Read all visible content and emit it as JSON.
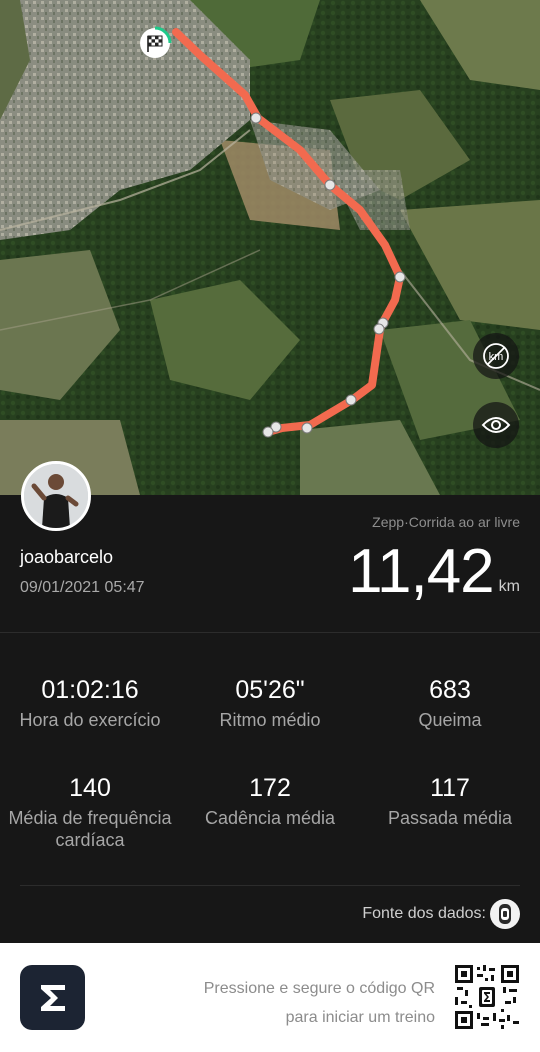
{
  "map": {
    "units_button_icon": "km-toggle-icon",
    "view_button_icon": "eye-icon",
    "start_marker_icon": "checkered-flag-icon",
    "route_color": "#f26a4f"
  },
  "profile": {
    "username": "joaobarcelo",
    "datetime": "09/01/2021 05:47",
    "avatar_icon": "user-avatar"
  },
  "summary": {
    "source": "Zepp·Corrida ao ar livre",
    "distance": "11,42",
    "distance_unit": "km"
  },
  "stats": [
    {
      "value": "01:02:16",
      "label": "Hora do exercício"
    },
    {
      "value": "05'26\"",
      "label": "Ritmo médio"
    },
    {
      "value": "683",
      "label": "Queima"
    },
    {
      "value": "140",
      "label": "Média de frequência cardíaca"
    },
    {
      "value": "172",
      "label": "Cadência média"
    },
    {
      "value": "117",
      "label": "Passada média"
    }
  ],
  "data_source": {
    "label": "Fonte dos dados:",
    "icon": "watch-icon"
  },
  "footer": {
    "logo_icon": "zepp-logo",
    "qr_line1": "Pressione e segure o código QR",
    "qr_line2": "para iniciar um treino",
    "qr_icon": "qr-code"
  }
}
